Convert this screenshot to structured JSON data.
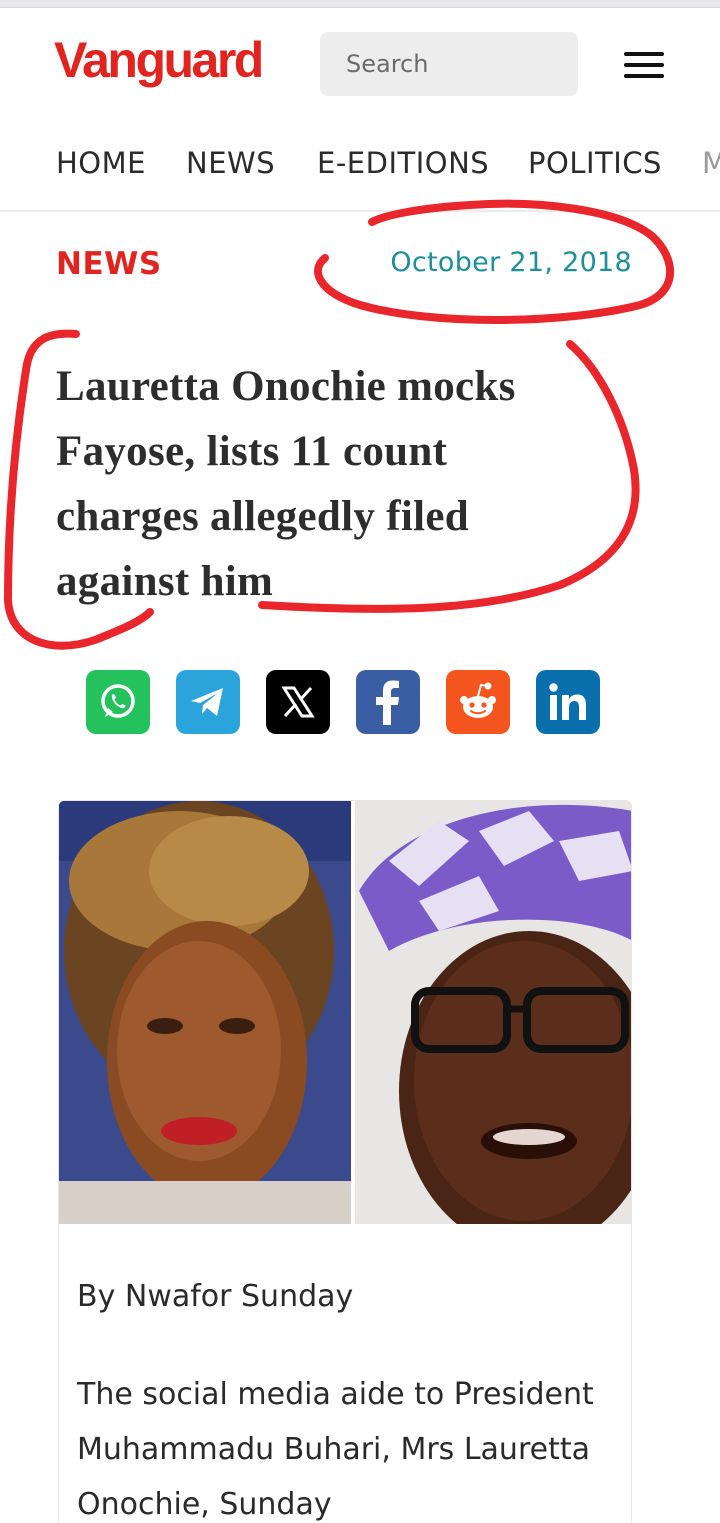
{
  "header": {
    "logo": "Vanguard",
    "search": {
      "placeholder": "Search"
    }
  },
  "nav": {
    "items": [
      "HOME",
      "NEWS",
      "E-EDITIONS",
      "POLITICS",
      "M"
    ]
  },
  "article": {
    "category": "NEWS",
    "date": "October 21, 2018",
    "headline": "Lauretta Onochie mocks Fayose, lists 11 count charges allegedly filed against him",
    "byline": "By Nwafor Sunday",
    "body": "The social media aide to President Muhammadu Buhari, Mrs Lauretta Onochie, Sunday"
  },
  "share": {
    "icons": [
      "whatsapp-icon",
      "telegram-icon",
      "x-icon",
      "facebook-icon",
      "reddit-icon",
      "linkedin-icon"
    ]
  },
  "colors": {
    "brand_red": "#e1241f",
    "date_teal": "#1c8f9a",
    "annotation_red": "#e8262b"
  }
}
